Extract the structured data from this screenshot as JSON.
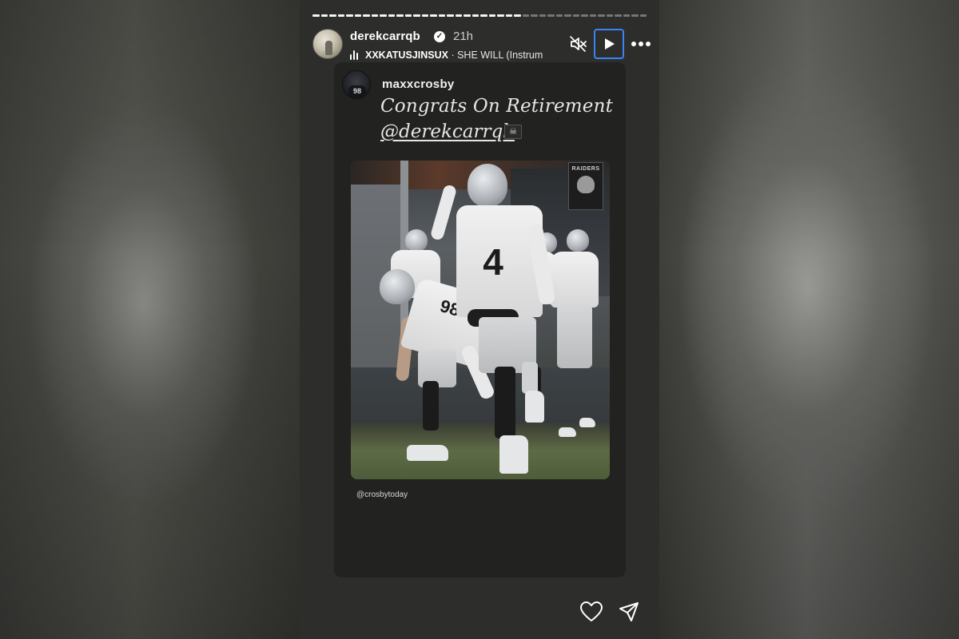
{
  "story": {
    "progress": {
      "total_segments": 40,
      "completed_segments": 25
    },
    "header": {
      "username": "derekcarrqb",
      "verified": true,
      "time": "21h",
      "music": {
        "artist": "XXKATUSJINSUX",
        "separator": " · ",
        "title": "SHE WILL (Instrum"
      },
      "controls": {
        "mute_icon": "speaker-muted-icon",
        "play_icon": "play-icon",
        "more_icon": "more-horizontal-icon"
      }
    },
    "shared_post": {
      "username": "maxxcrosby",
      "caption_line1": "Congrats On Retirement",
      "caption_mention": "@derekcarrqb",
      "flag_emoji": "☠",
      "photo_description": "Raiders players running out of the tunnel",
      "photo_credit": "@crosbytoday",
      "banner_text": "RAIDERS",
      "player_numbers": [
        "4",
        "98"
      ]
    },
    "footer": {
      "like_icon": "heart-icon",
      "share_icon": "send-icon"
    },
    "accent_color": "#3b82f6"
  }
}
